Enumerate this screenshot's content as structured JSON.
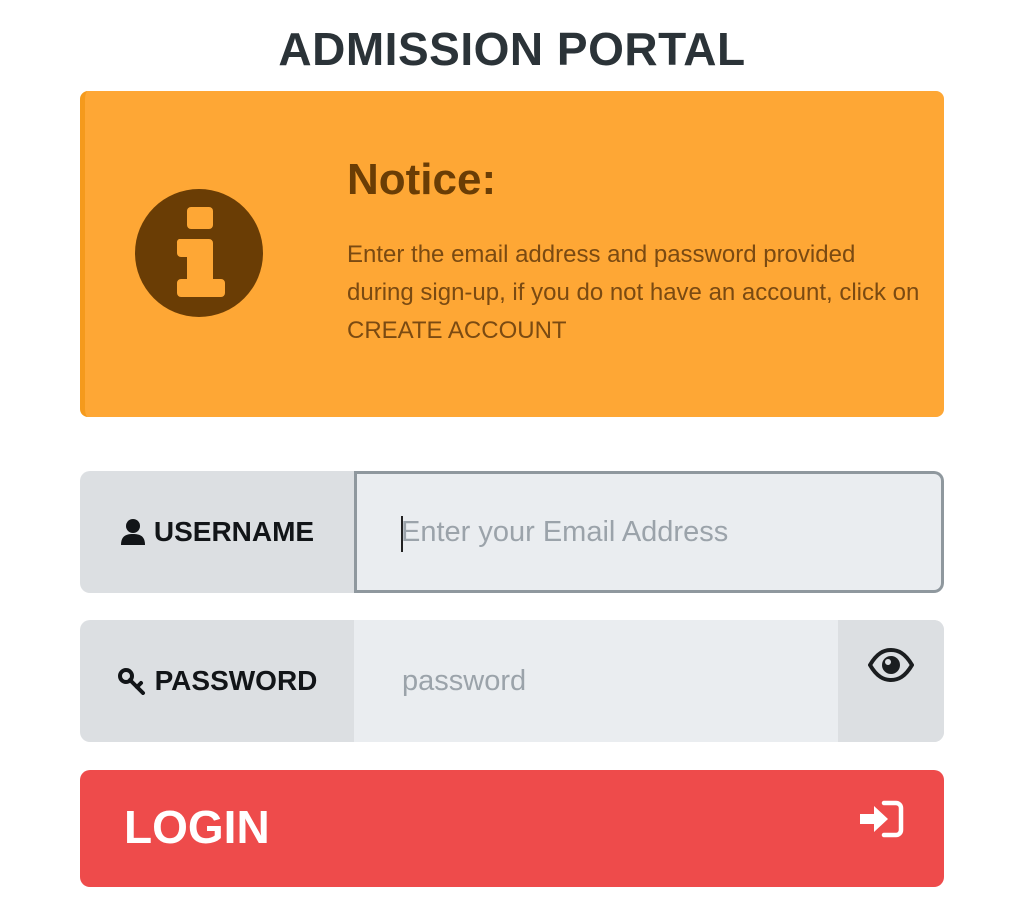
{
  "page": {
    "title": "ADMISSION PORTAL"
  },
  "notice": {
    "icon": "info-icon",
    "title": "Notice:",
    "text": "Enter the email address and password provided during sign-up, if you do not have an account, click on CREATE ACCOUNT"
  },
  "username": {
    "icon": "user-icon",
    "label": "USERNAME",
    "value": "",
    "placeholder": "Enter your Email Address"
  },
  "password": {
    "icon": "key-icon",
    "label": "PASSWORD",
    "value": "",
    "placeholder": "password",
    "toggle_icon": "eye-icon"
  },
  "login": {
    "label": "LOGIN",
    "icon": "sign-in-icon"
  },
  "colors": {
    "notice_bg": "#fea735",
    "notice_text": "#7a4a12",
    "login_bg": "#ee4b4b",
    "field_bg": "#eaedf0",
    "label_bg": "#dcdfe2"
  }
}
